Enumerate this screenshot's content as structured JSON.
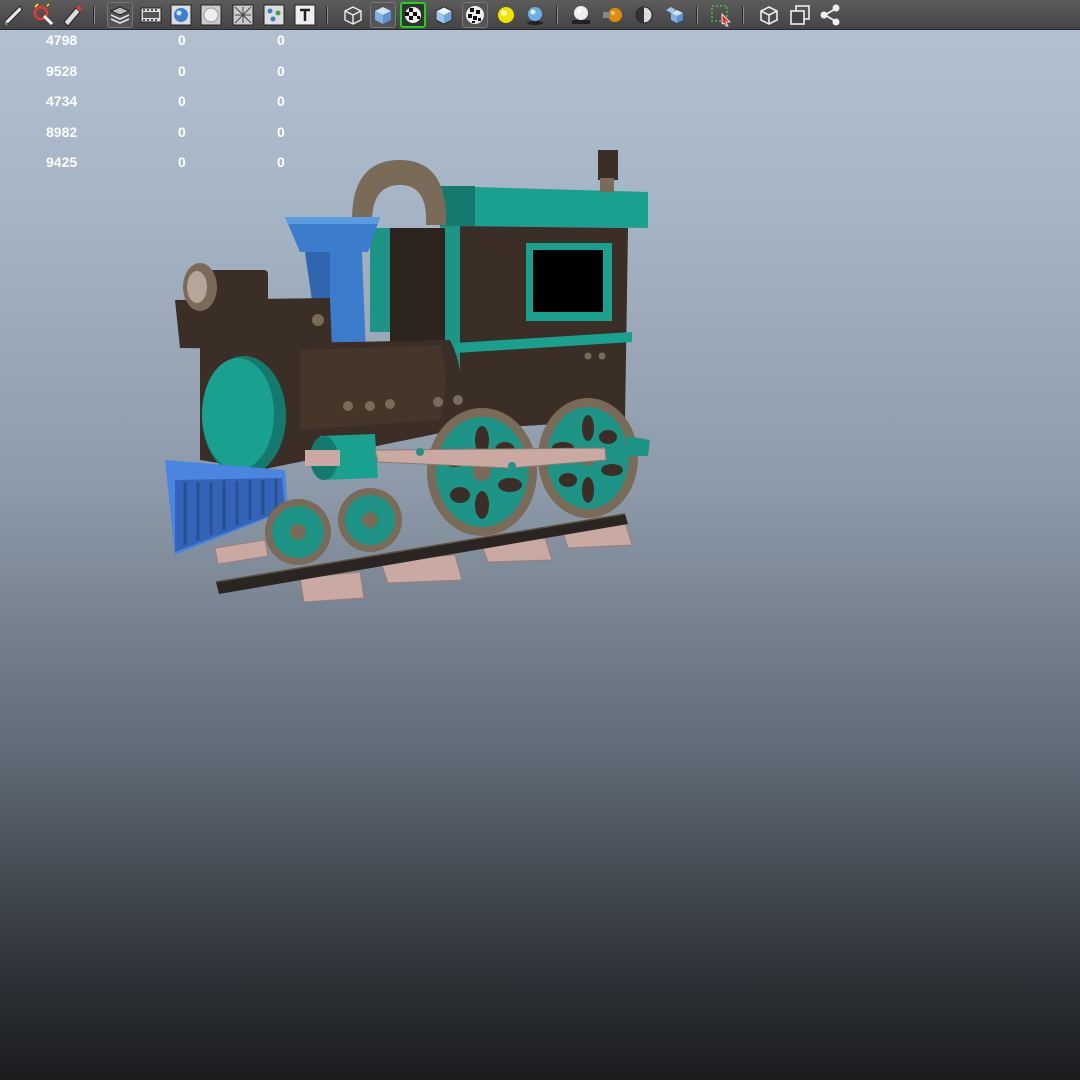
{
  "toolbar": {
    "icons": [
      "select-icon",
      "lasso-magnet-icon",
      "paint-brush-icon",
      "camera-attributes-icon",
      "film-gate-icon",
      "smooth-shade-icon",
      "wireframe-on-shaded-icon",
      "wireframe-icon",
      "grid-dots-icon",
      "text-icon",
      "wireframe-cube-icon",
      "shaded-cube-icon",
      "xray-checker-icon",
      "default-material-icon",
      "checker-texture-icon",
      "lighting-sun-icon",
      "shadow-sphere-icon",
      "ambient-occlusion-icon",
      "light-bulb-icon",
      "half-sphere-icon",
      "isolate-select-icon",
      "select-highlight-icon",
      "cube-outline-icon",
      "copy-layers-icon",
      "share-nodes-icon"
    ]
  },
  "hud": {
    "rows": [
      {
        "value": "4798",
        "a": "0",
        "b": "0"
      },
      {
        "value": "9528",
        "a": "0",
        "b": "0"
      },
      {
        "value": "4734",
        "a": "0",
        "b": "0"
      },
      {
        "value": "8982",
        "a": "0",
        "b": "0"
      },
      {
        "value": "9425",
        "a": "0",
        "b": "0"
      }
    ]
  },
  "scene": {
    "object": "toy-train-locomotive",
    "colors": {
      "teal": "#1e9486",
      "body": "#3a2e26",
      "stack_blue": "#3b7ccc",
      "cowcatcher_blue": "#4a85e0",
      "wheel_rim": "#7a6a58",
      "rail": "#2a2520",
      "tie": "#c9a9a2"
    }
  }
}
